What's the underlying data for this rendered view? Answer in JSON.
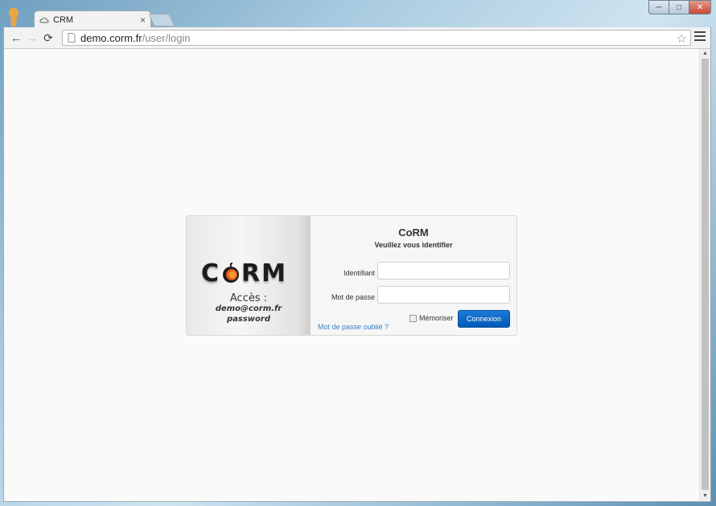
{
  "browser": {
    "tab": {
      "title": "CRM",
      "close_glyph": "×",
      "icon": "cloud-icon"
    },
    "address_bar": {
      "host": "demo.corm.fr",
      "path": "/user/login"
    },
    "window_controls": {
      "minimize": "─",
      "maximize": "□",
      "close": "✕"
    },
    "nav": {
      "back": "←",
      "forward": "→",
      "reload": "⟳",
      "bookmark": "☆"
    }
  },
  "login": {
    "logo_left": "C",
    "logo_right": "RM",
    "access_title": "Accès :",
    "access_email": "demo@corm.fr",
    "access_password": "password",
    "form_title": "CoRM",
    "form_subtitle": "Veuillez vous identifier",
    "username_label": "Identifiant",
    "password_label": "Mot de passe",
    "username_value": "",
    "password_value": "",
    "remember_label": "Mémoriser",
    "remember_checked": false,
    "submit_label": "Connexion",
    "forgot_link": "Mot de passe oublié ?"
  },
  "colors": {
    "accent": "#0068c9",
    "link": "#3b7fc4",
    "logo_apple": "#e85a1e"
  }
}
